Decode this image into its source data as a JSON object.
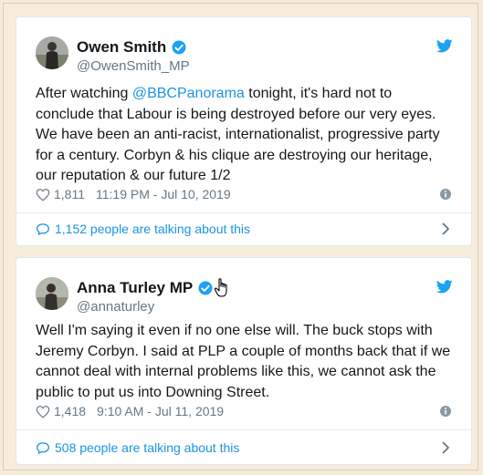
{
  "tweets": [
    {
      "name": "Owen Smith",
      "handle": "@OwenSmith_MP",
      "text_pre": "After watching ",
      "mention": "@BBCPanorama",
      "text_post": " tonight, it's hard not to conclude that Labour is being destroyed before our very eyes. We have been an anti-racist, internationalist, progressive party for a century. Corbyn & his clique are destroying our heritage, our reputation & our future 1/2",
      "likes": "1,811",
      "timestamp": "11:19 PM - Jul 10, 2019",
      "talking": "1,152 people are talking about this"
    },
    {
      "name": "Anna Turley MP",
      "handle": "@annaturley",
      "text": "Well I'm saying it even if no one else will. The buck stops with Jeremy Corbyn. I said at PLP a couple of months back that if we cannot deal with internal problems like this, we cannot ask the public to put us into Downing Street.",
      "likes": "1,418",
      "timestamp": "9:10 AM - Jul 11, 2019",
      "talking": "508 people are talking about this"
    }
  ],
  "icons": {
    "verified": "verified-badge-icon",
    "brand": "twitter-bird-icon",
    "like": "heart-icon",
    "info": "info-icon",
    "conversation": "speech-bubble-icon",
    "more": "chevron-right-icon",
    "pointer": "hand-cursor-icon"
  },
  "colors": {
    "link": "#1b95e0",
    "secondary_text": "#657786",
    "primary_text": "#14171a",
    "background": "#f6eedb"
  }
}
